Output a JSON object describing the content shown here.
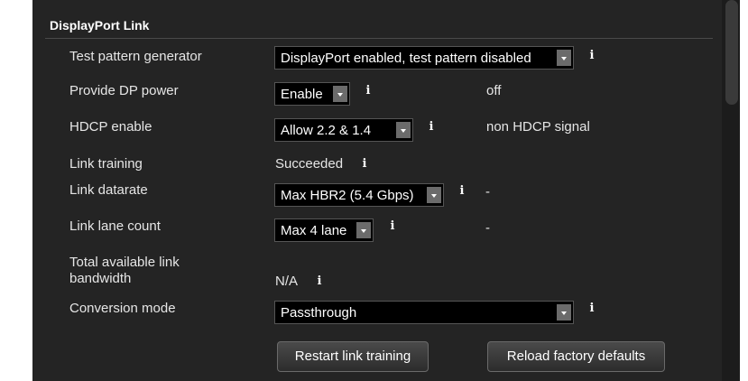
{
  "section": {
    "title": "DisplayPort Link"
  },
  "rows": {
    "test_pattern": {
      "label": "Test pattern generator",
      "selected": "DisplayPort enabled, test pattern disabled"
    },
    "dp_power": {
      "label": "Provide DP power",
      "selected": "Enable",
      "status": "off"
    },
    "hdcp": {
      "label": "HDCP enable",
      "selected": "Allow 2.2 & 1.4",
      "status": "non HDCP signal"
    },
    "link_training": {
      "label": "Link training",
      "value": "Succeeded"
    },
    "link_datarate": {
      "label": "Link datarate",
      "selected": "Max HBR2 (5.4 Gbps)",
      "status": "-"
    },
    "link_lane": {
      "label": "Link lane count",
      "selected": "Max 4 lane",
      "status": "-"
    },
    "bandwidth": {
      "label_line1": "Total available link",
      "label_line2": "bandwidth",
      "value": "N/A"
    },
    "conversion": {
      "label": "Conversion mode",
      "selected": "Passthrough"
    }
  },
  "buttons": {
    "restart": "Restart link training",
    "reload": "Reload factory defaults"
  },
  "icons": {
    "info": "info-icon",
    "dropdown": "chevron-down-icon"
  },
  "info_glyph": "i"
}
